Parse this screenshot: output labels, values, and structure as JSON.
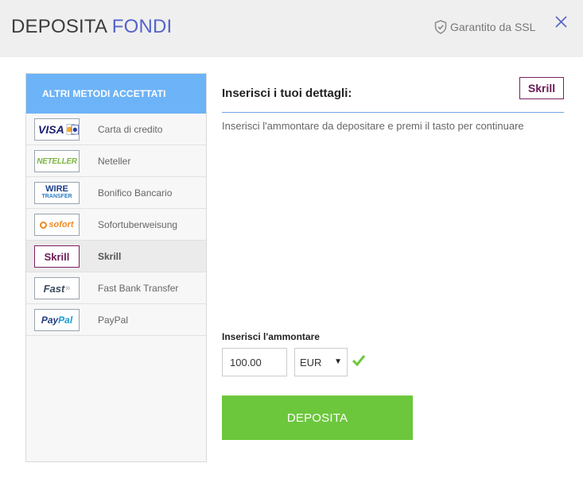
{
  "header": {
    "title_part1": "DEPOSITA",
    "title_part2": "FONDI",
    "ssl_text": "Garantito da SSL",
    "ssl_icon": "shield-check-icon",
    "close_icon": "close-icon"
  },
  "sidebar": {
    "heading": "ALTRI METODI ACCETTATI",
    "items": [
      {
        "label": "Carta di credito",
        "logo": "VISA"
      },
      {
        "label": "Neteller",
        "logo": "NETELLER"
      },
      {
        "label": "Bonifico Bancario",
        "logo_top": "WIRE",
        "logo_bottom": "TRANSFER"
      },
      {
        "label": "Sofortuberweisung",
        "logo": "sofort"
      },
      {
        "label": "Skrill",
        "logo": "Skrill",
        "active": true
      },
      {
        "label": "Fast Bank Transfer",
        "logo": "Fast"
      },
      {
        "label": "PayPal",
        "logo_a": "Pay",
        "logo_b": "Pal"
      }
    ]
  },
  "main": {
    "title": "Inserisci i tuoi dettagli:",
    "badge": "Skrill",
    "instructions": "Inserisci l'ammontare da depositare e premi il tasto per continuare",
    "amount_label": "Inserisci l'ammontare",
    "amount_value": "100.00",
    "currency": "EUR",
    "submit_label": "DEPOSITA"
  },
  "colors": {
    "accent_blue": "#5564c9",
    "sidebar_header": "#6db3f7",
    "button_green": "#6cc73c",
    "skrill_purple": "#6b1a55"
  }
}
